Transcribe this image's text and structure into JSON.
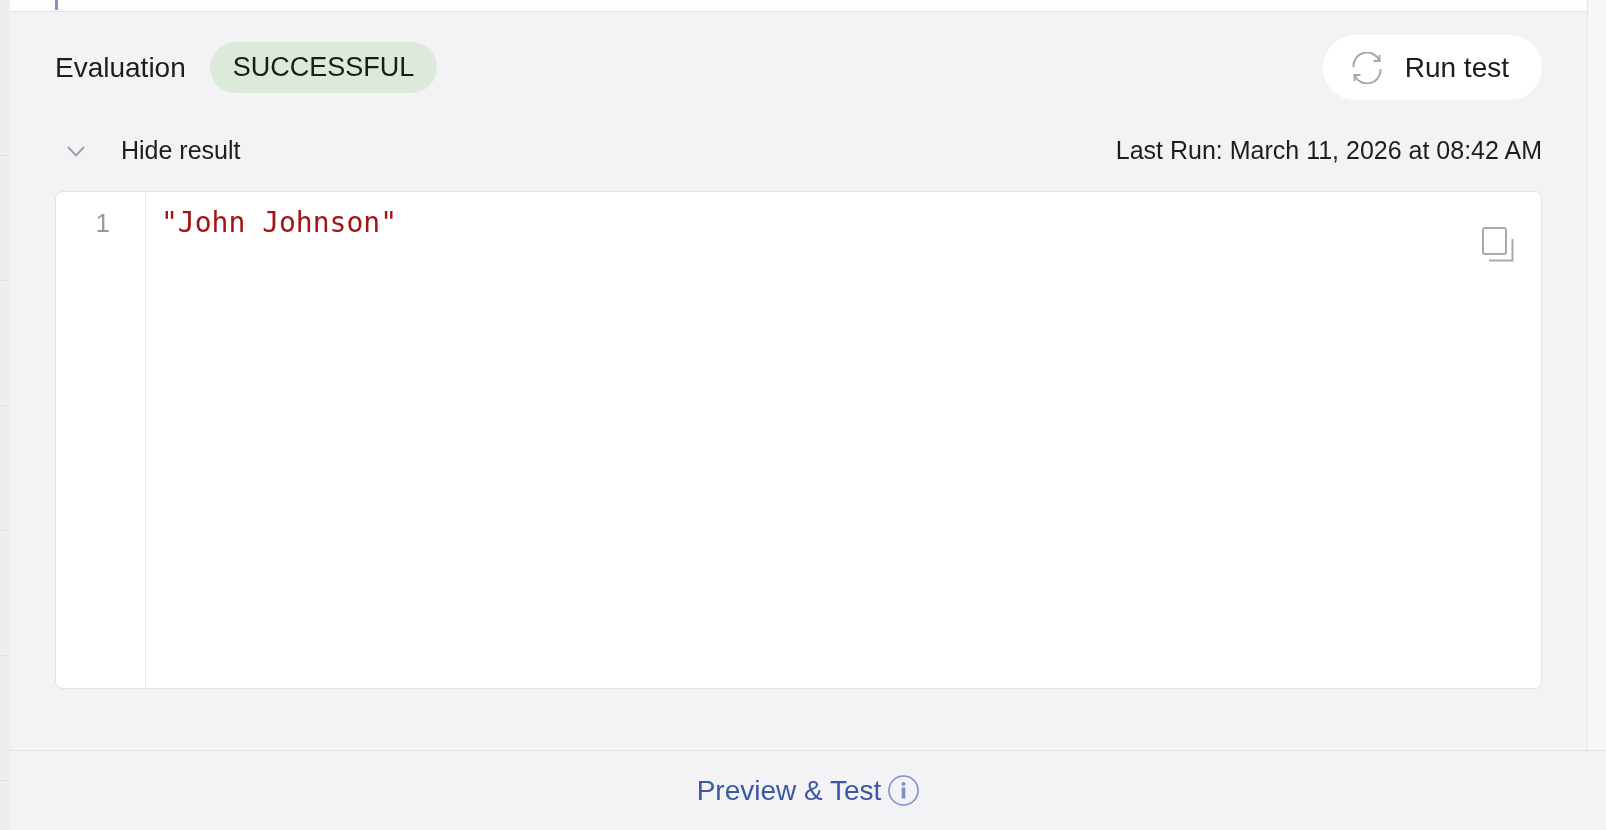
{
  "evaluation": {
    "label": "Evaluation",
    "status": {
      "text": "SUCCESSFUL",
      "kind": "success"
    }
  },
  "run_button": {
    "label": "Run test"
  },
  "result_toggle": {
    "label": "Hide result",
    "expanded": true
  },
  "last_run": "Last Run: March 11, 2026 at 08:42 AM",
  "result_editor": {
    "lines": [
      {
        "number": "1",
        "text": "\"John Johnson\"",
        "kind": "string"
      }
    ]
  },
  "footer": {
    "link": "Preview & Test"
  }
}
